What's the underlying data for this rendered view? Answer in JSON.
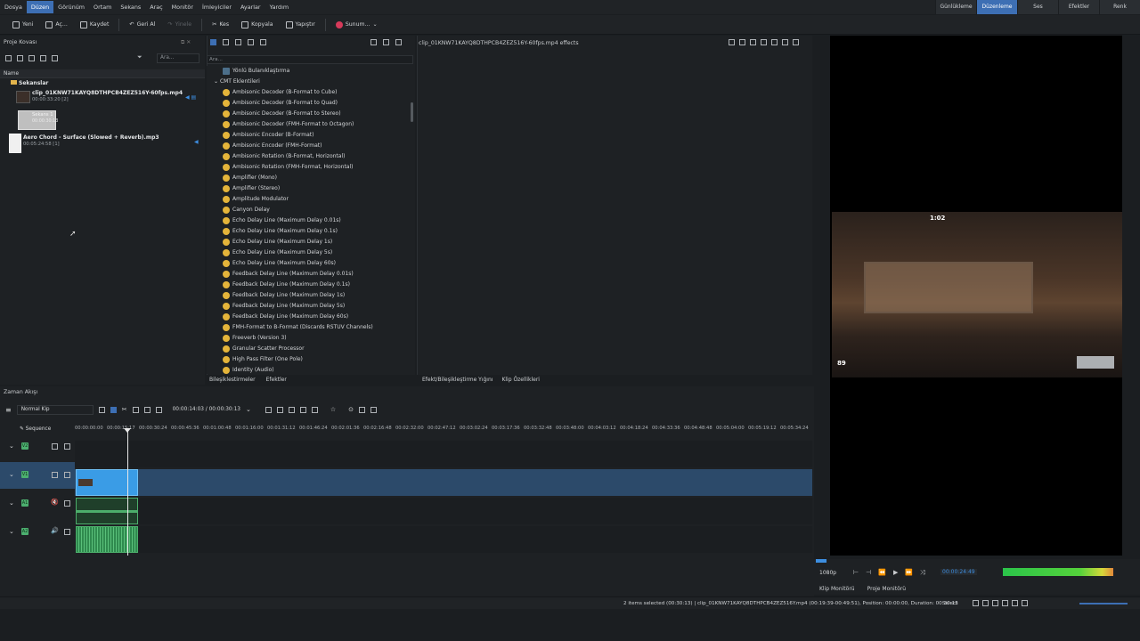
{
  "menu": [
    "Dosya",
    "Düzen",
    "Görünüm",
    "Ortam",
    "Sekans",
    "Araç",
    "Monitör",
    "İmleyiciler",
    "Ayarlar",
    "Yardım"
  ],
  "menu_active_index": 1,
  "workspaces": [
    "Günlükleme",
    "Düzenleme",
    "Ses",
    "Efektler",
    "Renk"
  ],
  "workspace_active_index": 1,
  "toolbar": {
    "new": "Yeni",
    "open": "Aç...",
    "save": "Kaydet",
    "undo": "Geri Al",
    "redo": "Yinele",
    "cut": "Kes",
    "copy": "Kopyala",
    "paste": "Yapıştır",
    "render": "Sunum..."
  },
  "project": {
    "title": "Proje Kovası",
    "search_placeholder": "Ara...",
    "column_name": "Name",
    "folder": "Sekanslar",
    "items": [
      {
        "name": "clip_01KNW71KAYQ8DTHPCB4ZEZ516Y-60fps.mp4",
        "meta": "00:00:33:20 [2]"
      },
      {
        "name": "Sekans 1",
        "meta": "00:00:30:13"
      },
      {
        "name": "Aero Chord - Surface (Slowed + Reverb).mp3",
        "meta": "00:05:24:58 [1]"
      }
    ]
  },
  "effects": {
    "search_placeholder": "Ara...",
    "top_item": "Yönlü Bulanıklaştırma",
    "category": "CMT Eklentileri",
    "items": [
      "Ambisonic Decoder (B-Format to Cube)",
      "Ambisonic Decoder (B-Format to Quad)",
      "Ambisonic Decoder (B-Format to Stereo)",
      "Ambisonic Decoder (FMH-Format to Octagon)",
      "Ambisonic Encoder (B-Format)",
      "Ambisonic Encoder (FMH-Format)",
      "Ambisonic Rotation (B-Format, Horizontal)",
      "Ambisonic Rotation (FMH-Format, Horizontal)",
      "Amplifier (Mono)",
      "Amplifier (Stereo)",
      "Amplitude Modulator",
      "Canyon Delay",
      "Echo Delay Line (Maximum Delay 0.01s)",
      "Echo Delay Line (Maximum Delay 0.1s)",
      "Echo Delay Line (Maximum Delay 1s)",
      "Echo Delay Line (Maximum Delay 5s)",
      "Echo Delay Line (Maximum Delay 60s)",
      "Feedback Delay Line (Maximum Delay 0.01s)",
      "Feedback Delay Line (Maximum Delay 0.1s)",
      "Feedback Delay Line (Maximum Delay 1s)",
      "Feedback Delay Line (Maximum Delay 5s)",
      "Feedback Delay Line (Maximum Delay 60s)",
      "FMH-Format to B-Format (Discards RSTUV Channels)",
      "Freeverb (Version 3)",
      "Granular Scatter Processor",
      "High Pass Filter (One Pole)",
      "Identity (Audio)"
    ],
    "tab_left": "Bileşiklestirmeler",
    "tab_right": "Efektler"
  },
  "effect_stack": {
    "title": "clip_01KNW71KAYQ8DTHPCB4ZEZ516Y-60fps.mp4 effects",
    "tab_left": "Efekt/Bileşikleştirme Yığını",
    "tab_right": "Klip Özellikleri"
  },
  "timeline": {
    "title": "Zaman Akışı",
    "mode": "Normal Kip",
    "position": "00:00:14:03 / 00:00:30:13",
    "sequence_label": "Sequence",
    "ruler": [
      "00:00:00:00",
      "00:00:15:17",
      "00:00:30:24",
      "00:00:45:36",
      "00:01:00:48",
      "00:01:16:00",
      "00:01:31:12",
      "00:01:46:24",
      "00:02:01:36",
      "00:02:16:48",
      "00:02:32:00",
      "00:02:47:12",
      "00:03:02:24",
      "00:03:17:36",
      "00:03:32:48",
      "00:03:48:00",
      "00:04:03:12",
      "00:04:18:24",
      "00:04:33:36",
      "00:04:48:48",
      "00:05:04:00",
      "00:05:19:12",
      "00:05:34:24"
    ],
    "tracks": [
      "V2",
      "V1",
      "A1",
      "A2"
    ]
  },
  "monitor": {
    "zoom": "1080p",
    "timecode": "00:00:24:49",
    "tab_clip": "Klip Monitörü",
    "tab_project": "Proje Monitörü",
    "hud_time": "1:02",
    "hud_score": "89"
  },
  "status": {
    "text": "2 items selected (00:30:13) | clip_01KNW71KAYQ8DTHPCB4ZEZ516Y.mp4 (00:19:39-00:49:51), Position: 00:00:00, Duration: 00:30:13",
    "select": "Select"
  },
  "colors": {
    "accent": "#3d6fb4",
    "video_clip": "#3a9ce6",
    "audio_clip": "#2f8a4e"
  }
}
